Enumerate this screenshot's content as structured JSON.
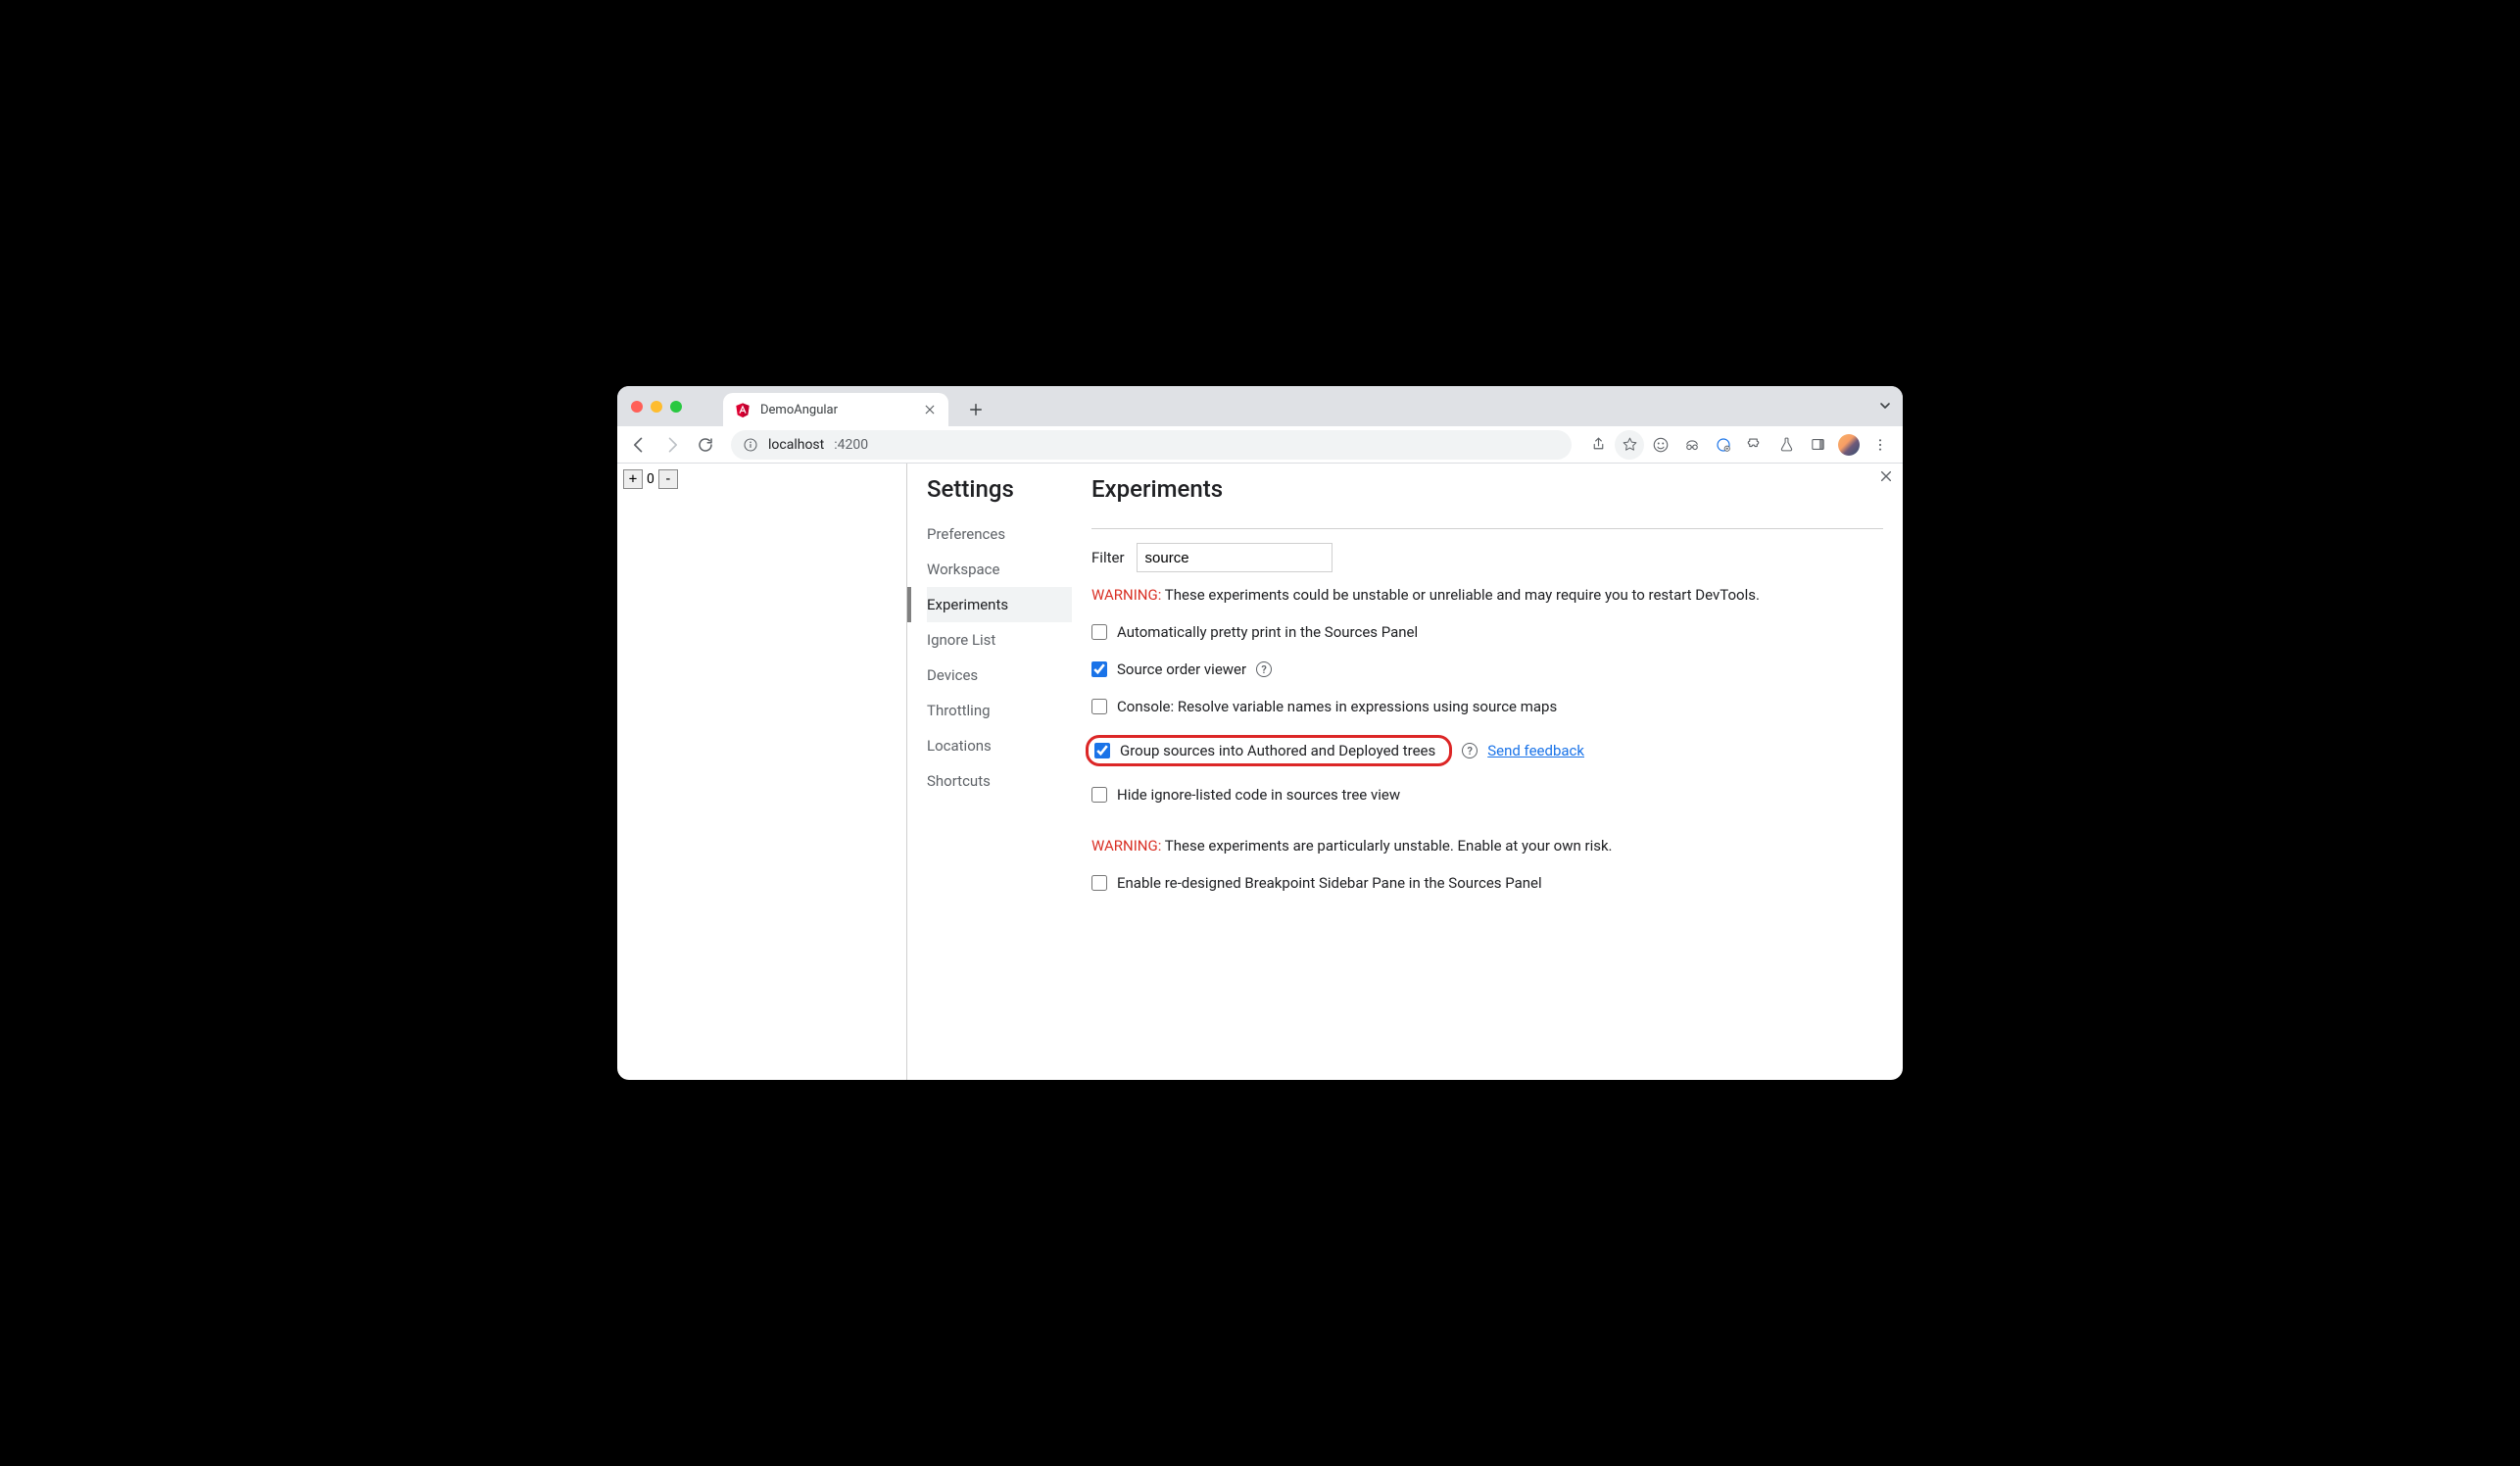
{
  "browser_tab": {
    "title": "DemoAngular"
  },
  "omnibox": {
    "host": "localhost",
    "port": ":4200"
  },
  "counter": {
    "value": "0"
  },
  "settings_title": "Settings",
  "nav_items": [
    {
      "label": "Preferences",
      "active": false
    },
    {
      "label": "Workspace",
      "active": false
    },
    {
      "label": "Experiments",
      "active": true
    },
    {
      "label": "Ignore List",
      "active": false
    },
    {
      "label": "Devices",
      "active": false
    },
    {
      "label": "Throttling",
      "active": false
    },
    {
      "label": "Locations",
      "active": false
    },
    {
      "label": "Shortcuts",
      "active": false
    }
  ],
  "experiments": {
    "title": "Experiments",
    "filter_label": "Filter",
    "filter_value": "source",
    "warning1_label": "WARNING:",
    "warning1_text": " These experiments could be unstable or unreliable and may require you to restart DevTools.",
    "warning2_label": "WARNING:",
    "warning2_text": " These experiments are particularly unstable. Enable at your own risk.",
    "items1": [
      {
        "label": "Automatically pretty print in the Sources Panel",
        "checked": false,
        "help": false
      },
      {
        "label": "Source order viewer",
        "checked": true,
        "help": true
      },
      {
        "label": "Console: Resolve variable names in expressions using source maps",
        "checked": false,
        "help": false
      },
      {
        "label": "Group sources into Authored and Deployed trees",
        "checked": true,
        "help": true,
        "highlight": true,
        "feedback": "Send feedback"
      },
      {
        "label": "Hide ignore-listed code in sources tree view",
        "checked": false,
        "help": false
      }
    ],
    "items2": [
      {
        "label": "Enable re-designed Breakpoint Sidebar Pane in the Sources Panel",
        "checked": false,
        "help": false
      }
    ]
  }
}
